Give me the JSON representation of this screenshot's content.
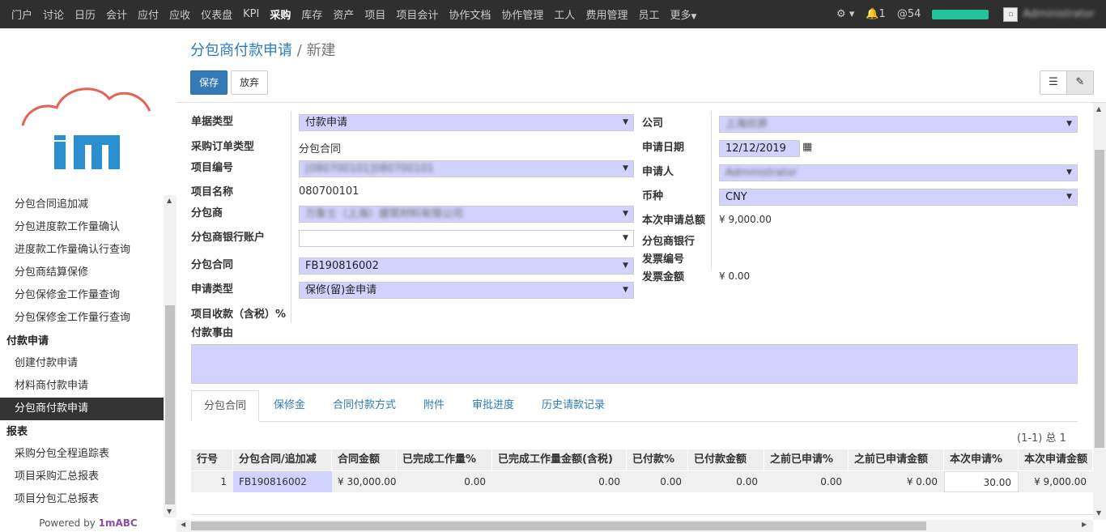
{
  "topnav": {
    "items": [
      "门户",
      "讨论",
      "日历",
      "会计",
      "应付",
      "应收",
      "仪表盘",
      "KPI",
      "采购",
      "库存",
      "资产",
      "项目",
      "项目会计",
      "协作文档",
      "协作管理",
      "工人",
      "费用管理",
      "员工",
      "更多"
    ],
    "active_index": 8,
    "notification_count": "1",
    "mention_count": "54",
    "user_name": "Administrator"
  },
  "sidebar": {
    "items": [
      {
        "type": "item",
        "label": "分包合同追加减"
      },
      {
        "type": "item",
        "label": "分包进度款工作量确认"
      },
      {
        "type": "item",
        "label": "进度款工作量确认行查询"
      },
      {
        "type": "item",
        "label": "分包商结算保修"
      },
      {
        "type": "item",
        "label": "分包保修金工作量查询"
      },
      {
        "type": "item",
        "label": "分包保修金工作量行查询"
      },
      {
        "type": "header",
        "label": "付款申请"
      },
      {
        "type": "item",
        "label": "创建付款申请"
      },
      {
        "type": "item",
        "label": "材料商付款申请"
      },
      {
        "type": "item",
        "label": "分包商付款申请",
        "active": true
      },
      {
        "type": "header",
        "label": "报表"
      },
      {
        "type": "item",
        "label": "采购分包全程追踪表"
      },
      {
        "type": "item",
        "label": "项目采购汇总报表"
      },
      {
        "type": "item",
        "label": "项目分包汇总报表"
      }
    ],
    "powered_prefix": "Powered by ",
    "powered_brand": "1mABC"
  },
  "breadcrumb": {
    "parent": "分包商付款申请",
    "sep": "/",
    "current": "新建"
  },
  "buttons": {
    "save": "保存",
    "discard": "放弃"
  },
  "form": {
    "doc_type_label": "单据类型",
    "doc_type_value": "付款申请",
    "po_type_label": "采购订单类型",
    "po_type_value": "分包合同",
    "project_code_label": "项目编号",
    "project_code_value": "[080700101]080700101",
    "project_name_label": "项目名称",
    "project_name_value": "080700101",
    "subcontractor_label": "分包商",
    "subcontractor_value": "万象士（上海）建筑材料有限公司",
    "bank_account_label": "分包商银行账户",
    "bank_account_value": "",
    "contract_label": "分包合同",
    "contract_value": "FB190816002",
    "apply_type_label": "申请类型",
    "apply_type_value": "保修(留)金申请",
    "income_label": "项目收款（含税）%",
    "reason_label": "付款事由",
    "company_label": "公司",
    "company_value": "上海玖骅",
    "date_label": "申请日期",
    "date_value": "12/12/2019",
    "applicant_label": "申请人",
    "applicant_value": "Administrator",
    "currency_label": "币种",
    "currency_value": "CNY",
    "total_label": "本次申请总额",
    "total_value": "¥ 9,000.00",
    "sub_bank_label": "分包商银行",
    "invoice_no_label": "发票编号",
    "invoice_amount_label": "发票金额",
    "invoice_amount_value": "¥ 0.00"
  },
  "tabs": [
    "分包合同",
    "保修金",
    "合同付款方式",
    "附件",
    "审批进度",
    "历史请款记录"
  ],
  "pager": "(1-1) 总 1",
  "grid": {
    "headers": [
      "行号",
      "分包合同/追加减",
      "合同金额",
      "已完成工作量%",
      "已完成工作量金额(含税)",
      "已付款%",
      "已付款金额",
      "之前已申请%",
      "之前已申请金额",
      "本次申请%",
      "本次申请金额"
    ],
    "row": [
      "1",
      "FB190816002",
      "¥ 30,000.00",
      "0.00",
      "0.00",
      "0.00",
      "0.00",
      "0.00",
      "¥ 0.00",
      "30.00",
      "¥ 9,000.00"
    ]
  },
  "colors": {
    "topbar": "#2f2f2f",
    "accent": "#337ab7",
    "required_field": "#d2d2ff",
    "status_bar": "#22c29a"
  }
}
